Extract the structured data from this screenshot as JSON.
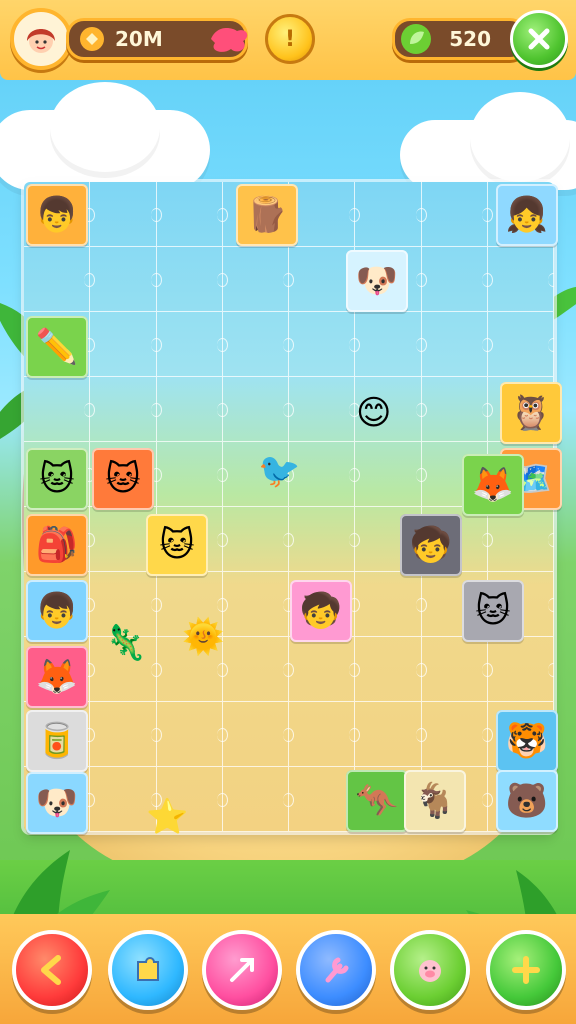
{
  "hud": {
    "currency_amount": "20M",
    "coin_symbol": "!",
    "score_value": "520",
    "close_symbol": "✕"
  },
  "board": {
    "tiles": [
      {
        "name": "tile-boy",
        "glyph": "👦",
        "color": "#ffb13b"
      },
      {
        "name": "tile-log",
        "glyph": "🪵",
        "color": "#ffc24a"
      },
      {
        "name": "tile-girl",
        "glyph": "👧",
        "color": "#8fd9ff"
      },
      {
        "name": "tile-dog",
        "glyph": "🐶",
        "color": "#d6f3ff"
      },
      {
        "name": "tile-pencil",
        "glyph": "✏️",
        "color": "#7ad34c"
      },
      {
        "name": "tile-cat-pink",
        "glyph": "🐱",
        "color": "#8ad463"
      },
      {
        "name": "tile-cat-red",
        "glyph": "🐱",
        "color": "#ff7a3a"
      },
      {
        "name": "tile-owl",
        "glyph": "🦉",
        "color": "#ffc93a"
      },
      {
        "name": "tile-map",
        "glyph": "🗺️",
        "color": "#ff9a3a"
      },
      {
        "name": "tile-fox",
        "glyph": "🦊",
        "color": "#7ad34c"
      },
      {
        "name": "tile-bag",
        "glyph": "🎒",
        "color": "#ff9a2a"
      },
      {
        "name": "tile-cat-blue",
        "glyph": "🐱",
        "color": "#ffd84a"
      },
      {
        "name": "tile-kid-red",
        "glyph": "🧒",
        "color": "#6d6d78"
      },
      {
        "name": "tile-boy-2",
        "glyph": "👦",
        "color": "#7fd3ff"
      },
      {
        "name": "tile-hood",
        "glyph": "🧒",
        "color": "#ff9ad2"
      },
      {
        "name": "tile-cat-grey",
        "glyph": "🐱",
        "color": "#a8a8b0"
      },
      {
        "name": "tile-fox-2",
        "glyph": "🦊",
        "color": "#ff5e8a"
      },
      {
        "name": "tile-cup",
        "glyph": "🥫",
        "color": "#dcdcdc"
      },
      {
        "name": "tile-tiger",
        "glyph": "🐯",
        "color": "#5cc3f2"
      },
      {
        "name": "tile-corgi",
        "glyph": "🐶",
        "color": "#8ad8ff"
      },
      {
        "name": "tile-kangaroo",
        "glyph": "🦘",
        "color": "#63c545"
      },
      {
        "name": "tile-goat",
        "glyph": "🐐",
        "color": "#f3e5b0"
      },
      {
        "name": "tile-bear",
        "glyph": "🐻",
        "color": "#8fdcff"
      }
    ],
    "floating": [
      {
        "name": "float-sun",
        "glyph": "🌞"
      },
      {
        "name": "float-smile",
        "glyph": "😊"
      },
      {
        "name": "float-bird",
        "glyph": "🐦"
      },
      {
        "name": "float-lizard",
        "glyph": "🦎"
      },
      {
        "name": "float-starfish",
        "glyph": "⭐"
      }
    ]
  },
  "toolbar": {
    "buttons": [
      {
        "name": "back-button",
        "icon": "chevron-left-icon",
        "color": "#ff3b3b"
      },
      {
        "name": "hint-button",
        "icon": "piece-icon",
        "color": "#2fb8ff"
      },
      {
        "name": "shuffle-button",
        "icon": "arrow-icon",
        "color": "#ff4fa0"
      },
      {
        "name": "tools-button",
        "icon": "wrench-icon",
        "color": "#3d8dff"
      },
      {
        "name": "pets-button",
        "icon": "pig-icon",
        "color": "#6ccf33"
      },
      {
        "name": "add-button",
        "icon": "plus-icon",
        "color": "#45c93a"
      }
    ]
  }
}
